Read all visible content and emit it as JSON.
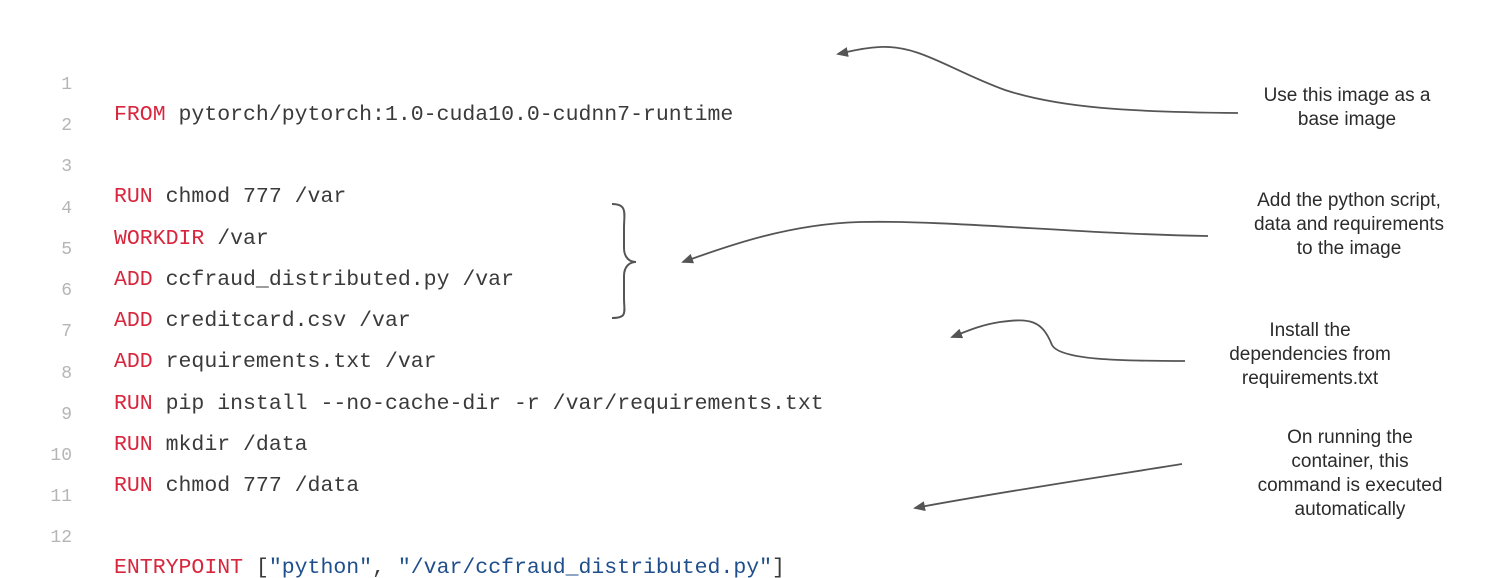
{
  "code": {
    "lines": [
      {
        "num": "1",
        "kw": "FROM",
        "rest": " pytorch/pytorch:1.0-cuda10.0-cudnn7-runtime"
      },
      {
        "num": "2",
        "kw": "",
        "rest": ""
      },
      {
        "num": "3",
        "kw": "RUN",
        "rest": " chmod 777 /var"
      },
      {
        "num": "4",
        "kw": "WORKDIR",
        "rest": " /var"
      },
      {
        "num": "5",
        "kw": "ADD",
        "rest": " ccfraud_distributed.py /var"
      },
      {
        "num": "6",
        "kw": "ADD",
        "rest": " creditcard.csv /var"
      },
      {
        "num": "7",
        "kw": "ADD",
        "rest": " requirements.txt /var"
      },
      {
        "num": "8",
        "kw": "RUN",
        "rest": " pip install --no-cache-dir -r /var/requirements.txt"
      },
      {
        "num": "9",
        "kw": "RUN",
        "rest": " mkdir /data"
      },
      {
        "num": "10",
        "kw": "RUN",
        "rest": " chmod 777 /data"
      },
      {
        "num": "11",
        "kw": "",
        "rest": ""
      },
      {
        "num": "12",
        "kw": "ENTRYPOINT",
        "rest": " [",
        "str1": "\"python\"",
        "sep": ", ",
        "str2": "\"/var/ccfraud_distributed.py\"",
        "end": "]"
      }
    ]
  },
  "annotations": {
    "base_image": [
      "Use this image as a",
      "base image"
    ],
    "add_files": [
      "Add the python script,",
      "data and requirements",
      "to the image"
    ],
    "install_deps": [
      "Install the",
      "dependencies from",
      "requirements.txt"
    ],
    "entrypoint": [
      "On running the",
      "container, this",
      "command is executed",
      "automatically"
    ]
  },
  "colors": {
    "keyword": "#d7263d",
    "string": "#1f4e8c",
    "text": "#3a3a3a",
    "line_number": "#b5b5b5",
    "arrow": "#555555"
  }
}
